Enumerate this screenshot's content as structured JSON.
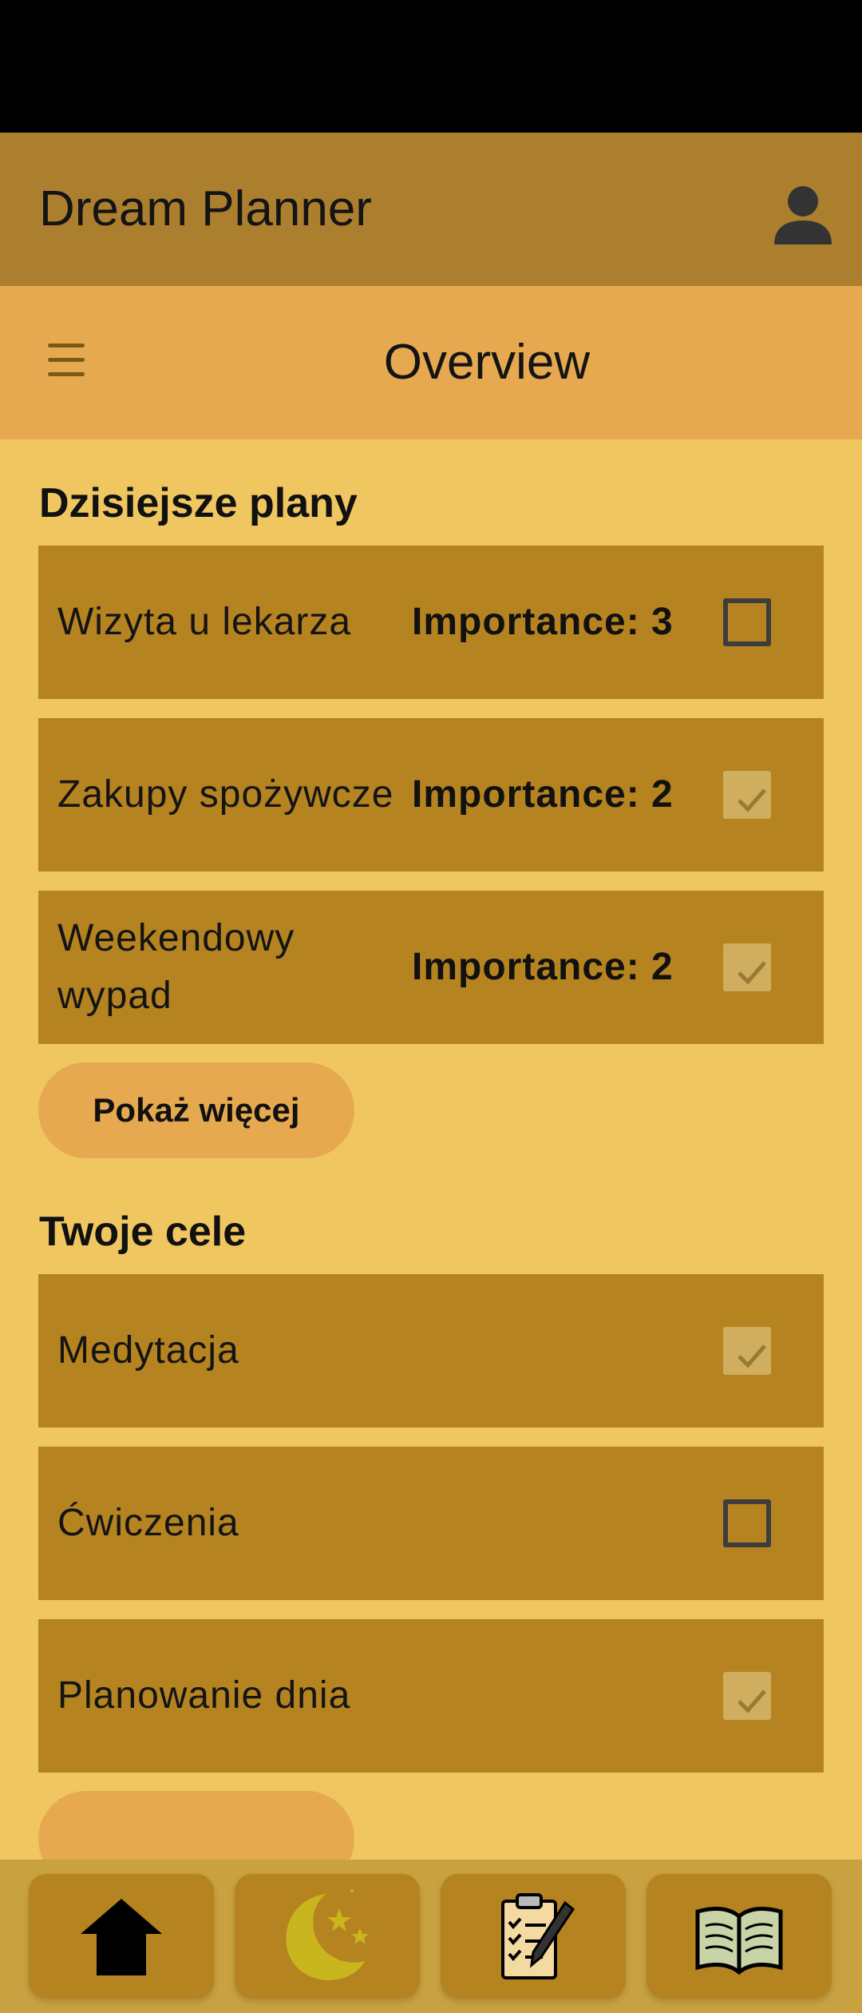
{
  "app_bar": {
    "title": "Dream Planner"
  },
  "sub_bar": {
    "title": "Overview"
  },
  "plans": {
    "title": "Dzisiejsze plany",
    "items": [
      {
        "label": "Wizyta u lekarza",
        "importance": "Importance: 3",
        "checked": false
      },
      {
        "label": "Zakupy spożywcze",
        "importance": "Importance: 2",
        "checked": true
      },
      {
        "label": "Weekendowy wypad",
        "importance": "Importance: 2",
        "checked": true
      }
    ],
    "more_label": "Pokaż więcej"
  },
  "goals": {
    "title": "Twoje cele",
    "items": [
      {
        "label": "Medytacja",
        "checked": true
      },
      {
        "label": "Ćwiczenia",
        "checked": false
      },
      {
        "label": "Planowanie dnia",
        "checked": true
      }
    ]
  },
  "bottom_nav": {
    "tabs": [
      {
        "icon": "home-icon"
      },
      {
        "icon": "moon-icon"
      },
      {
        "icon": "clipboard-icon"
      },
      {
        "icon": "book-icon"
      }
    ]
  },
  "colors": {
    "app_bar": "#ab7f2e",
    "sub_bar": "#e6a94f",
    "background": "#f0c660",
    "card": "#b5831f",
    "bottom_nav": "#c9a140"
  }
}
